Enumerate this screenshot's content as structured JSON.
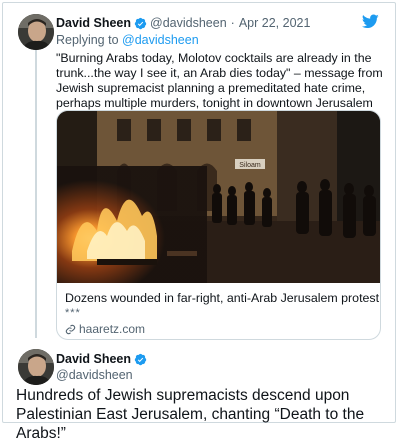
{
  "tweet1": {
    "author_name": "David Sheen",
    "author_handle": "@davidsheen",
    "separator": "·",
    "date": "Apr 22, 2021",
    "replying_prefix": "Replying to",
    "replying_handle": "@davidsheen",
    "text": "\"Burning Arabs today, Molotov cocktails are already in the trunk...the way I see it, an Arab dies today\" – message from Jewish supremacist planning a premeditated hate crime, perhaps multiple murders, tonight in downtown Jerusalem"
  },
  "card": {
    "title": "Dozens wounded in far-right, anti-Arab Jerusalem protest",
    "stars": "***",
    "domain": "haaretz.com",
    "photo_sign": "Siloam"
  },
  "tweet2": {
    "author_name": "David Sheen",
    "author_handle": "@davidsheen",
    "text": "Hundreds of Jewish supremacists descend upon Palestinian East Jerusalem, chanting “Death to the Arabs!”"
  },
  "colors": {
    "verified_badge": "#1d9bf0",
    "twitter_bird": "#1d9bf0",
    "link": "#1d9bf0",
    "secondary_text": "#536471"
  },
  "icons": [
    "verified-badge-icon",
    "twitter-bird-icon",
    "link-icon"
  ]
}
